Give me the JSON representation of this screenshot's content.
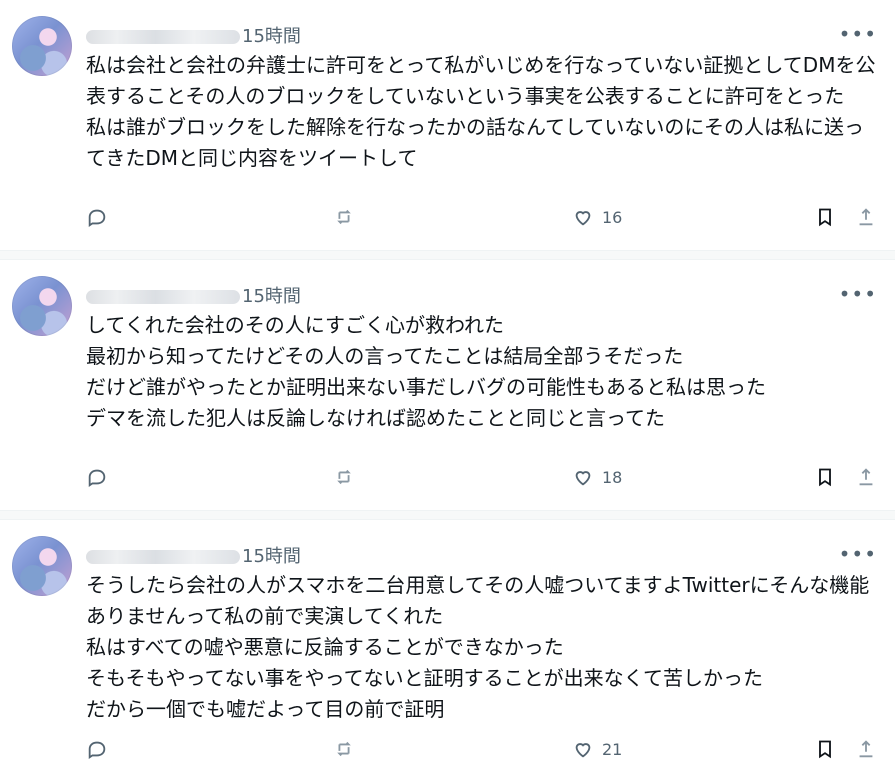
{
  "posts": [
    {
      "time": "15時間",
      "text": "私は会社と会社の弁護士に許可をとって私がいじめを行なっていない証拠としてDMを公表することその人のブロックをしていないという事実を公表することに許可をとった\n私は誰がブロックをした解除を行なったかの話なんてしていないのにその人は私に送ってきたDMと同じ内容をツイートして",
      "like_count": "16"
    },
    {
      "time": "15時間",
      "text": "してくれた会社のその人にすごく心が救われた\n最初から知ってたけどその人の言ってたことは結局全部うそだった\nだけど誰がやったとか証明出来ない事だしバグの可能性もあると私は思った\nデマを流した犯人は反論しなければ認めたことと同じと言ってた",
      "like_count": "18"
    },
    {
      "time": "15時間",
      "text": "そうしたら会社の人がスマホを二台用意してその人嘘ついてますよTwitterにそんな機能ありませんって私の前で実演してくれた\n私はすべての嘘や悪意に反論することができなかった\nそもそもやってない事をやってないと証明することが出来なくて苦しかった\nだから一個でも嘘だよって目の前で証明",
      "like_count": "21"
    }
  ],
  "icons": {
    "reply": "reply-icon",
    "retweet": "retweet-icon",
    "like": "heart-icon",
    "bookmark": "bookmark-icon",
    "share": "share-icon",
    "more": "more-icon"
  },
  "more_symbol": "•••",
  "colors": {
    "text": "#0f1419",
    "muted": "#536471",
    "divider_bg": "#f7f9f9"
  }
}
